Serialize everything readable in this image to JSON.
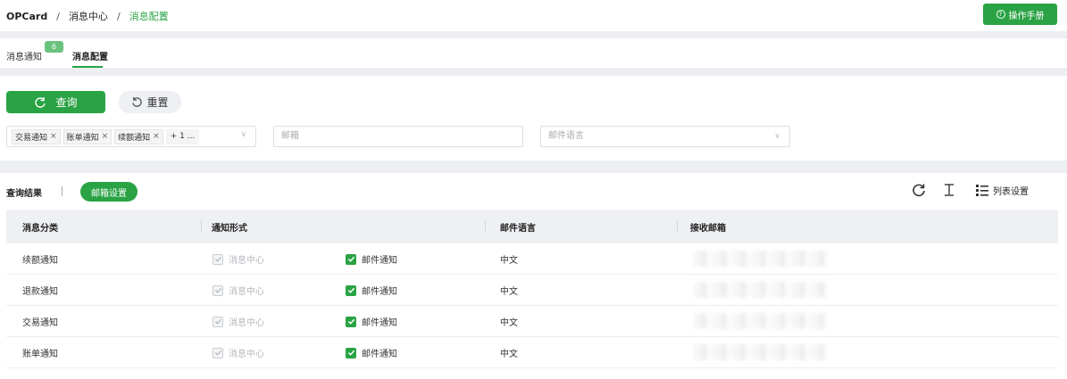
{
  "breadcrumb": {
    "root": "OPCard",
    "sep": "/",
    "middle": "消息中心",
    "current": "消息配置"
  },
  "header": {
    "manual_button": "操作手册",
    "manual_icon": "question-circle-icon"
  },
  "tabs": [
    {
      "label": "消息通知",
      "badge": "6"
    },
    {
      "label": "消息配置",
      "active": true
    }
  ],
  "filters": {
    "query_button": "查询",
    "reset_button": "重置",
    "category_tags": [
      "交易通知",
      "账单通知",
      "续额通知"
    ],
    "category_more": "+ 1 ...",
    "email_placeholder": "邮箱",
    "language_placeholder": "邮件语言"
  },
  "results": {
    "title": "查询结果",
    "email_settings_button": "邮箱设置",
    "column_settings_label": "列表设置"
  },
  "table": {
    "columns": [
      "消息分类",
      "通知形式",
      "邮件语言",
      "接收邮箱"
    ],
    "rows": [
      {
        "category": "续额通知",
        "message_center": "消息中心",
        "email_notify": "邮件通知",
        "language": "中文"
      },
      {
        "category": "退款通知",
        "message_center": "消息中心",
        "email_notify": "邮件通知",
        "language": "中文"
      },
      {
        "category": "交易通知",
        "message_center": "消息中心",
        "email_notify": "邮件通知",
        "language": "中文"
      },
      {
        "category": "账单通知",
        "message_center": "消息中心",
        "email_notify": "邮件通知",
        "language": "中文"
      }
    ]
  },
  "colors": {
    "accent": "#2aa345",
    "badge": "#6bc27e"
  }
}
